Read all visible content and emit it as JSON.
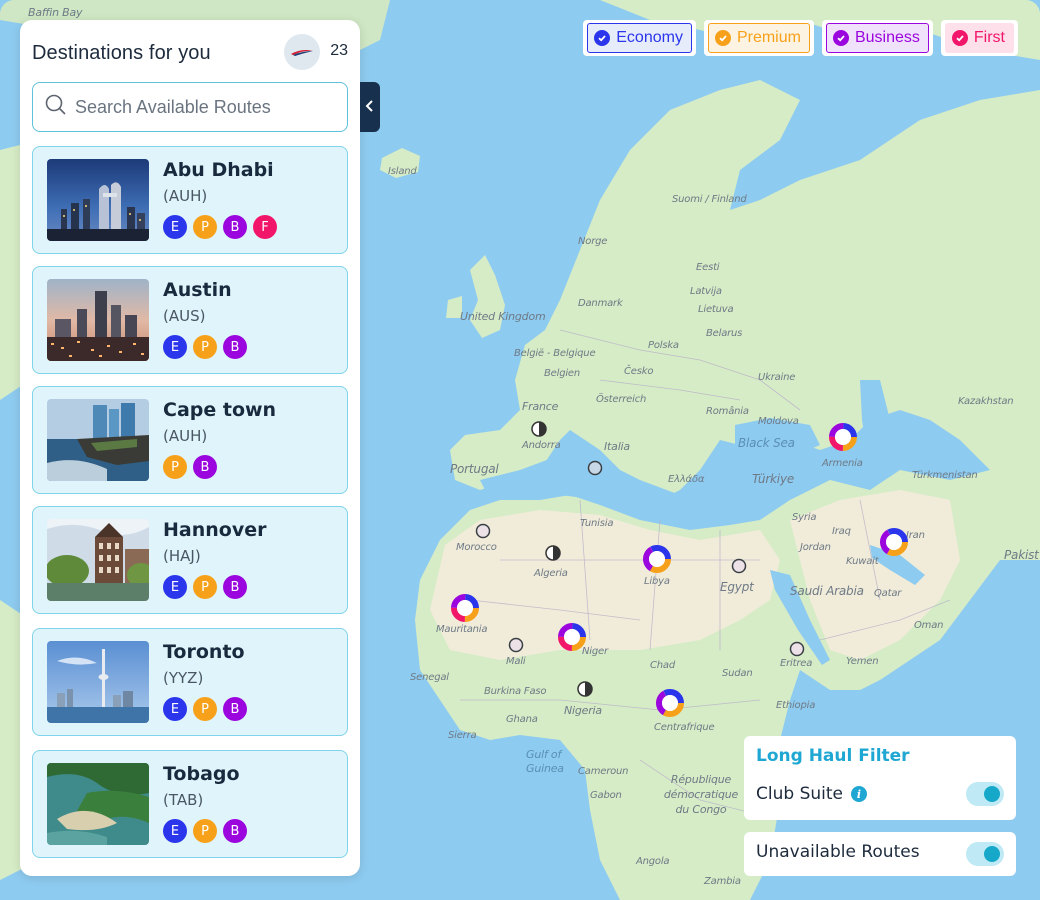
{
  "panel": {
    "title": "Destinations for you",
    "count": "23",
    "search_placeholder": "Search Available Routes"
  },
  "destinations": [
    {
      "city": "Abu Dhabi",
      "code": "(AUH)",
      "classes": [
        "E",
        "P",
        "B",
        "F"
      ]
    },
    {
      "city": "Austin",
      "code": "(AUS)",
      "classes": [
        "E",
        "P",
        "B"
      ]
    },
    {
      "city": "Cape town",
      "code": "(AUH)",
      "classes": [
        "P",
        "B"
      ]
    },
    {
      "city": "Hannover",
      "code": "(HAJ)",
      "classes": [
        "E",
        "P",
        "B"
      ]
    },
    {
      "city": "Toronto",
      "code": "(YYZ)",
      "classes": [
        "E",
        "P",
        "B"
      ]
    },
    {
      "city": "Tobago",
      "code": "(TAB)",
      "classes": [
        "E",
        "P",
        "B"
      ]
    }
  ],
  "class_filters": [
    {
      "label": "Economy",
      "checked": true
    },
    {
      "label": "Premium",
      "checked": true
    },
    {
      "label": "Business",
      "checked": true
    },
    {
      "label": "First",
      "checked": true
    }
  ],
  "long_haul_filter": {
    "title": "Long Haul Filter",
    "club_suite_label": "Club Suite",
    "club_suite_on": true,
    "unavailable_routes_label": "Unavailable Routes",
    "unavailable_routes_on": true
  },
  "map_labels": [
    "Baffin Bay",
    "Island",
    "Suomi / Finland",
    "Norge",
    "Eesti",
    "Latvija",
    "Lietuva",
    "Danmark",
    "United Kingdom",
    "Polska",
    "België - Belgique",
    "Belgien",
    "Česko",
    "Belarus",
    "Ukraine",
    "Österreich",
    "France",
    "România",
    "Moldova",
    "Kazakhstan",
    "Andorra",
    "Italia",
    "Portugal",
    "Black Sea",
    "Armenia",
    "Türkiye",
    "Türkmenistan",
    "Ελλάδα",
    "Tunisia",
    "Syria",
    "Iraq",
    "Iran",
    "Morocco",
    "Algeria",
    "Libya",
    "Egypt",
    "Jordan",
    "Kuwait",
    "Saudi Arabia",
    "Qatar",
    "Pakist",
    "Mauritania",
    "Mali",
    "Niger",
    "Chad",
    "Sudan",
    "Eritrea",
    "Yemen",
    "Oman",
    "Burkina Faso",
    "Nigeria",
    "Ghana",
    "Senegal",
    "Sierra",
    "Ethiopia",
    "Centrafrique",
    "Gulf of Guinea",
    "Cameroun",
    "Gabon",
    "République démocratique du Congo",
    "Angola",
    "Zambia"
  ],
  "colors": {
    "economy": "#2a35ec",
    "premium": "#f7a11a",
    "business": "#9a06dd",
    "first": "#f2166a",
    "accent": "#1fa7d3",
    "sea": "#8ecbf0",
    "land": "#d6ecc6"
  }
}
